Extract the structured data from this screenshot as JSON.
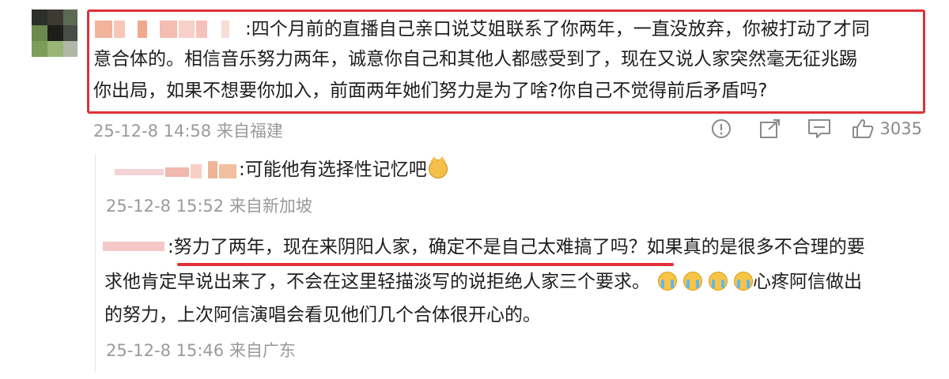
{
  "main_comment": {
    "user_prefix": ":",
    "line1": "四个月前的直播自己亲口说艾姐联系了你两年，一直没放弃，你被打动了才同",
    "line2": "意合体的。相信音乐努力两年，诚意你自己和其他人都感受到了，现在又说人家突然毫无征兆踢",
    "line3": "你出局，如果不想要你加入，前面两年她们努力是为了啥?你自己不觉得前后矛盾吗?",
    "timestamp": "25-12-8 14:58",
    "location": "来自福建",
    "like_count": "3035",
    "actions": [
      "report-icon",
      "share-icon",
      "comment-icon",
      "like-icon"
    ]
  },
  "replies": [
    {
      "text": ":可能他有选择性记忆吧",
      "emoji": "cat-emoji",
      "timestamp": "25-12-8 15:52",
      "location": "来自新加坡"
    },
    {
      "line1_a": ":努力了两年，现在来阴阳人家，确定不是自己太难搞了吗？",
      "line1_b": "如果真的是很多不合理的要",
      "line2_a": "求他肯定早说出来了，不会在这里轻描淡写的说拒绝人家三个要求。",
      "line2_b": "心疼阿信做出",
      "line3": "的努力，上次阿信演唱会看见他们几个合体很开心的。",
      "emoji": "crying-emoji",
      "timestamp": "25-12-8 15:46",
      "location": "来自广东"
    }
  ],
  "colors": {
    "highlight": "#e0303a",
    "meta_text": "#9a9a9a",
    "body_text": "#1e1e1e"
  }
}
